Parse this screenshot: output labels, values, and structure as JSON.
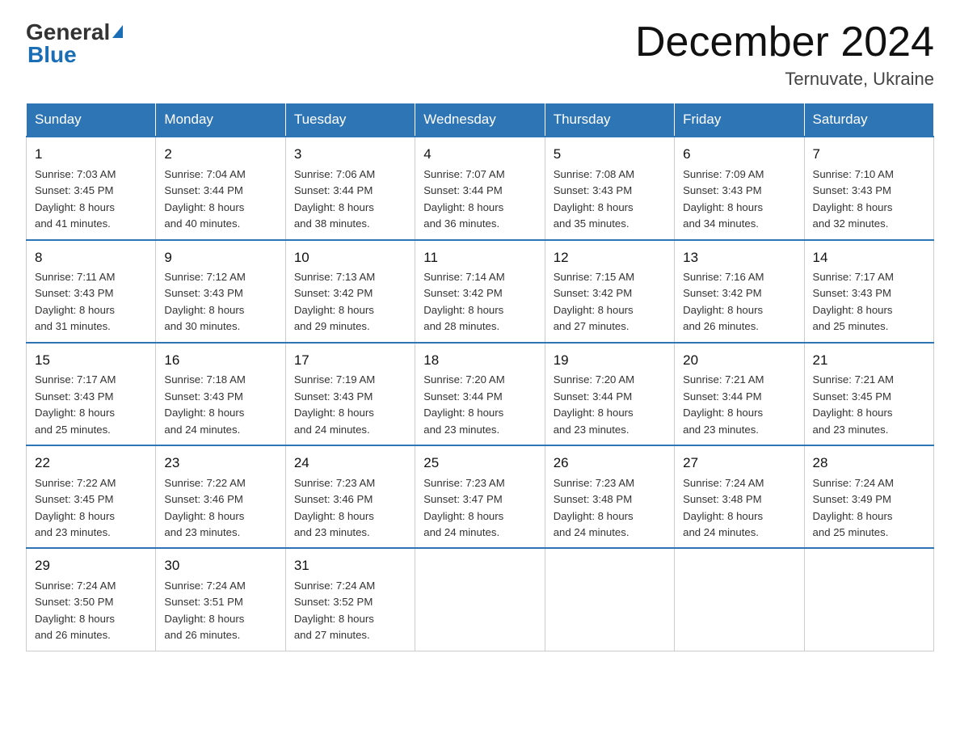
{
  "logo": {
    "general": "General",
    "blue": "Blue",
    "triangle": "▲"
  },
  "title": "December 2024",
  "subtitle": "Ternuvate, Ukraine",
  "days_of_week": [
    "Sunday",
    "Monday",
    "Tuesday",
    "Wednesday",
    "Thursday",
    "Friday",
    "Saturday"
  ],
  "weeks": [
    [
      {
        "day": "1",
        "sunrise": "7:03 AM",
        "sunset": "3:45 PM",
        "daylight": "8 hours and 41 minutes."
      },
      {
        "day": "2",
        "sunrise": "7:04 AM",
        "sunset": "3:44 PM",
        "daylight": "8 hours and 40 minutes."
      },
      {
        "day": "3",
        "sunrise": "7:06 AM",
        "sunset": "3:44 PM",
        "daylight": "8 hours and 38 minutes."
      },
      {
        "day": "4",
        "sunrise": "7:07 AM",
        "sunset": "3:44 PM",
        "daylight": "8 hours and 36 minutes."
      },
      {
        "day": "5",
        "sunrise": "7:08 AM",
        "sunset": "3:43 PM",
        "daylight": "8 hours and 35 minutes."
      },
      {
        "day": "6",
        "sunrise": "7:09 AM",
        "sunset": "3:43 PM",
        "daylight": "8 hours and 34 minutes."
      },
      {
        "day": "7",
        "sunrise": "7:10 AM",
        "sunset": "3:43 PM",
        "daylight": "8 hours and 32 minutes."
      }
    ],
    [
      {
        "day": "8",
        "sunrise": "7:11 AM",
        "sunset": "3:43 PM",
        "daylight": "8 hours and 31 minutes."
      },
      {
        "day": "9",
        "sunrise": "7:12 AM",
        "sunset": "3:43 PM",
        "daylight": "8 hours and 30 minutes."
      },
      {
        "day": "10",
        "sunrise": "7:13 AM",
        "sunset": "3:42 PM",
        "daylight": "8 hours and 29 minutes."
      },
      {
        "day": "11",
        "sunrise": "7:14 AM",
        "sunset": "3:42 PM",
        "daylight": "8 hours and 28 minutes."
      },
      {
        "day": "12",
        "sunrise": "7:15 AM",
        "sunset": "3:42 PM",
        "daylight": "8 hours and 27 minutes."
      },
      {
        "day": "13",
        "sunrise": "7:16 AM",
        "sunset": "3:42 PM",
        "daylight": "8 hours and 26 minutes."
      },
      {
        "day": "14",
        "sunrise": "7:17 AM",
        "sunset": "3:43 PM",
        "daylight": "8 hours and 25 minutes."
      }
    ],
    [
      {
        "day": "15",
        "sunrise": "7:17 AM",
        "sunset": "3:43 PM",
        "daylight": "8 hours and 25 minutes."
      },
      {
        "day": "16",
        "sunrise": "7:18 AM",
        "sunset": "3:43 PM",
        "daylight": "8 hours and 24 minutes."
      },
      {
        "day": "17",
        "sunrise": "7:19 AM",
        "sunset": "3:43 PM",
        "daylight": "8 hours and 24 minutes."
      },
      {
        "day": "18",
        "sunrise": "7:20 AM",
        "sunset": "3:44 PM",
        "daylight": "8 hours and 23 minutes."
      },
      {
        "day": "19",
        "sunrise": "7:20 AM",
        "sunset": "3:44 PM",
        "daylight": "8 hours and 23 minutes."
      },
      {
        "day": "20",
        "sunrise": "7:21 AM",
        "sunset": "3:44 PM",
        "daylight": "8 hours and 23 minutes."
      },
      {
        "day": "21",
        "sunrise": "7:21 AM",
        "sunset": "3:45 PM",
        "daylight": "8 hours and 23 minutes."
      }
    ],
    [
      {
        "day": "22",
        "sunrise": "7:22 AM",
        "sunset": "3:45 PM",
        "daylight": "8 hours and 23 minutes."
      },
      {
        "day": "23",
        "sunrise": "7:22 AM",
        "sunset": "3:46 PM",
        "daylight": "8 hours and 23 minutes."
      },
      {
        "day": "24",
        "sunrise": "7:23 AM",
        "sunset": "3:46 PM",
        "daylight": "8 hours and 23 minutes."
      },
      {
        "day": "25",
        "sunrise": "7:23 AM",
        "sunset": "3:47 PM",
        "daylight": "8 hours and 24 minutes."
      },
      {
        "day": "26",
        "sunrise": "7:23 AM",
        "sunset": "3:48 PM",
        "daylight": "8 hours and 24 minutes."
      },
      {
        "day": "27",
        "sunrise": "7:24 AM",
        "sunset": "3:48 PM",
        "daylight": "8 hours and 24 minutes."
      },
      {
        "day": "28",
        "sunrise": "7:24 AM",
        "sunset": "3:49 PM",
        "daylight": "8 hours and 25 minutes."
      }
    ],
    [
      {
        "day": "29",
        "sunrise": "7:24 AM",
        "sunset": "3:50 PM",
        "daylight": "8 hours and 26 minutes."
      },
      {
        "day": "30",
        "sunrise": "7:24 AM",
        "sunset": "3:51 PM",
        "daylight": "8 hours and 26 minutes."
      },
      {
        "day": "31",
        "sunrise": "7:24 AM",
        "sunset": "3:52 PM",
        "daylight": "8 hours and 27 minutes."
      },
      null,
      null,
      null,
      null
    ]
  ],
  "labels": {
    "sunrise": "Sunrise: ",
    "sunset": "Sunset: ",
    "daylight": "Daylight: "
  }
}
